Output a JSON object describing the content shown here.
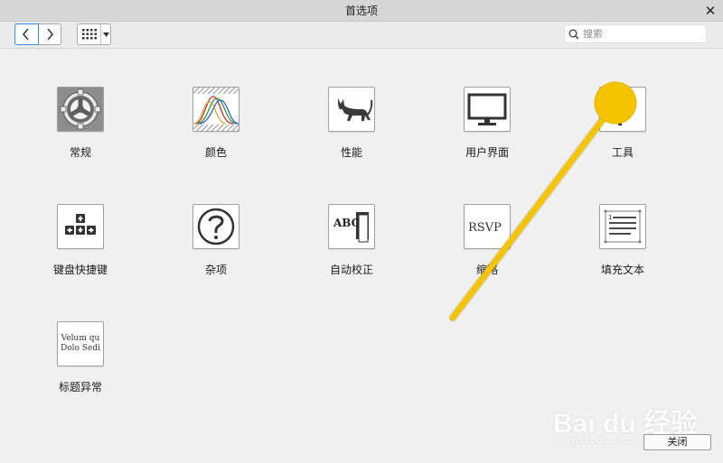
{
  "window": {
    "title": "首选项"
  },
  "toolbar": {
    "back_icon": "chevron-left-icon",
    "forward_icon": "chevron-right-icon",
    "grid_icon": "grid-icon",
    "search_placeholder": "搜索",
    "search_value": ""
  },
  "preferences": [
    {
      "label": "常规",
      "icon": "gear-icon"
    },
    {
      "label": "颜色",
      "icon": "color-curves-icon"
    },
    {
      "label": "性能",
      "icon": "cat-icon"
    },
    {
      "label": "用户界面",
      "icon": "monitor-icon"
    },
    {
      "label": "工具",
      "icon": "tool-icon"
    },
    {
      "label": "键盘快捷键",
      "icon": "keyboard-arrows-icon"
    },
    {
      "label": "杂项",
      "icon": "question-icon"
    },
    {
      "label": "自动校正",
      "icon": "abc-book-icon",
      "icon_text": "ABC"
    },
    {
      "label": "缩略",
      "icon": "rsvp-icon",
      "icon_text": "RSVP"
    },
    {
      "label": "填充文本",
      "icon": "document-lines-icon"
    },
    {
      "label": "标题异常",
      "icon": "text-sample-icon",
      "icon_text": "Velum qu Dolo Sedi"
    }
  ],
  "footer": {
    "close_label": "关闭"
  },
  "watermark": {
    "text": "Bai du 经验",
    "sub": "jingyan.baidu.com"
  },
  "colors": {
    "annotation": "#f5c400",
    "focus_blue": "#3c8ae6"
  }
}
